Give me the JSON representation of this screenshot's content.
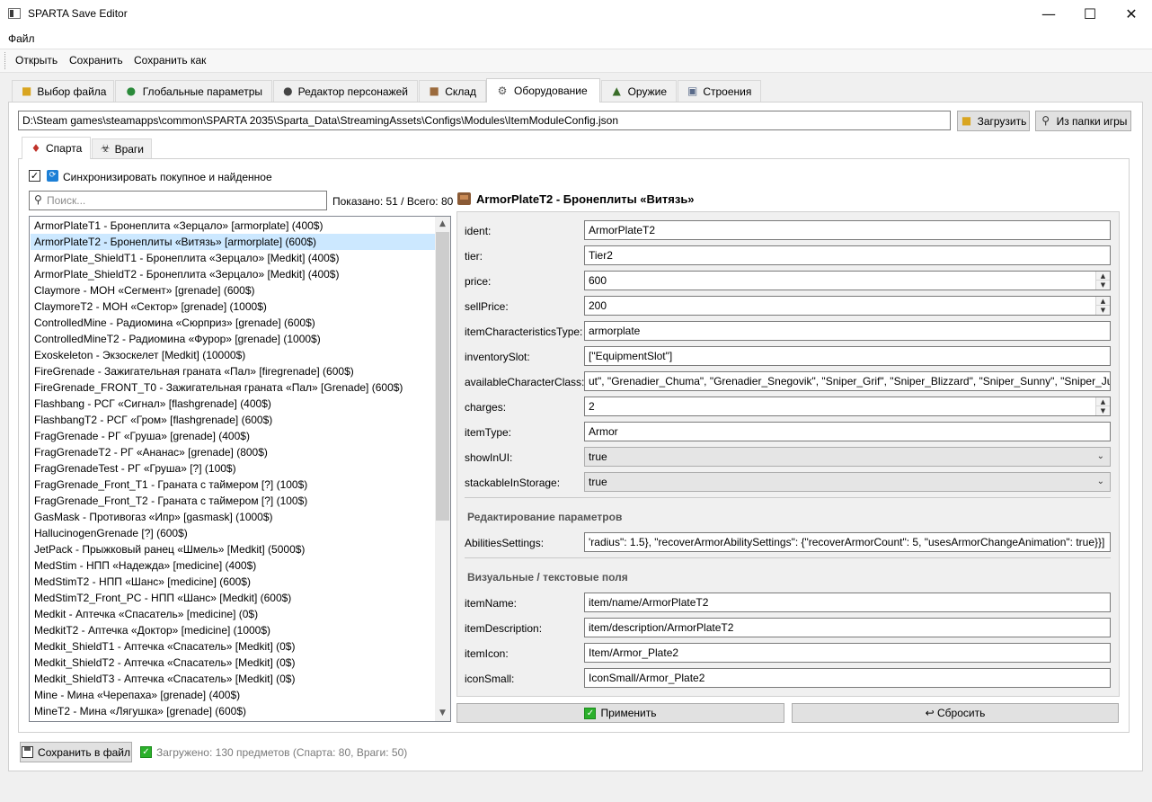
{
  "window": {
    "title": "SPARTA Save Editor",
    "minimize": "—",
    "maximize": "☐",
    "close": "✕"
  },
  "menu": {
    "file": "Файл"
  },
  "toolbar": {
    "open": "Открыть",
    "save": "Сохранить",
    "save_as": "Сохранить как"
  },
  "tabs": [
    {
      "label": "Выбор файла",
      "icon": "folder-icon"
    },
    {
      "label": "Глобальные параметры",
      "icon": "globe-icon"
    },
    {
      "label": "Редактор персонажей",
      "icon": "person-icon"
    },
    {
      "label": "Склад",
      "icon": "box-icon"
    },
    {
      "label": "Оборудование",
      "icon": "gear-icon"
    },
    {
      "label": "Оружие",
      "icon": "gun-icon"
    },
    {
      "label": "Строения",
      "icon": "building-icon"
    }
  ],
  "path": {
    "value": "D:\\Steam games\\steamapps\\common\\SPARTA 2035\\Sparta_Data\\StreamingAssets\\Configs\\Modules\\ItemModuleConfig.json",
    "load_button": "Загрузить",
    "game_folder_button": "Из папки игры"
  },
  "subtabs": [
    {
      "label": "Спарта",
      "icon": "shield-icon"
    },
    {
      "label": "Враги",
      "icon": "enemies-icon"
    }
  ],
  "sync": {
    "checked": true,
    "label": "Синхронизировать покупное и найденное"
  },
  "search": {
    "placeholder": "Поиск...",
    "count": "Показано: 51 / Всего: 80"
  },
  "items": [
    "ArmorPlateT1 - Бронеплита «Зерцало»  [armorplate]  (400$)",
    "ArmorPlateT2 - Бронеплиты «Витязь»  [armorplate]  (600$)",
    "ArmorPlate_ShieldT1 - Бронеплита «Зерцало»  [Medkit]  (400$)",
    "ArmorPlate_ShieldT2 - Бронеплита «Зерцало»  [Medkit]  (400$)",
    "Claymore - МОН «Сегмент»  [grenade]  (600$)",
    "ClaymoreT2 - МОН «Сектор»  [grenade]  (1000$)",
    "ControlledMine - Радиомина «Сюрприз»  [grenade]  (600$)",
    "ControlledMineT2 - Радиомина «Фурор»  [grenade]  (1000$)",
    "Exoskeleton - Экзоскелет  [Medkit]  (10000$)",
    "FireGrenade - Зажигательная граната «Пал»  [firegrenade]  (600$)",
    "FireGrenade_FRONT_T0 - Зажигательная граната «Пал»  [Grenade]  (600$)",
    "Flashbang - РСГ «Сигнал»  [flashgrenade]  (400$)",
    "FlashbangT2 - РСГ «Гром»  [flashgrenade]  (600$)",
    "FragGrenade - РГ «Груша»  [grenade]  (400$)",
    "FragGrenadeT2 - РГ «Ананас»  [grenade]  (800$)",
    "FragGrenadeTest - РГ «Груша»  [?]  (100$)",
    "FragGrenade_Front_T1 - Граната с таймером  [?]  (100$)",
    "FragGrenade_Front_T2 - Граната с таймером  [?]  (100$)",
    "GasMask - Противогаз «Ипр»  [gasmask]  (1000$)",
    "HallucinogenGrenade  [?]  (600$)",
    "JetPack - Прыжковый ранец «Шмель»  [Medkit]  (5000$)",
    "MedStim - НПП «Надежда»  [medicine]  (400$)",
    "MedStimT2 - НПП «Шанс»  [medicine]  (600$)",
    "MedStimT2_Front_PC - НПП «Шанс»  [Medkit]  (600$)",
    "Medkit - Аптечка «Спасатель»  [medicine]  (0$)",
    "MedkitT2 - Аптечка «Доктор»  [medicine]  (1000$)",
    "Medkit_ShieldT1 - Аптечка «Спасатель»  [Medkit]  (0$)",
    "Medkit_ShieldT2 - Аптечка «Спасатель»  [Medkit]  (0$)",
    "Medkit_ShieldT3 - Аптечка «Спасатель»  [Medkit]  (0$)",
    "Mine - Мина «Черепаха»  [grenade]  (400$)",
    "MineT2 - Мина «Лягушка»  [grenade]  (600$)"
  ],
  "selected_index": 1,
  "detail": {
    "title": "ArmorPlateT2 - Бронеплиты «Витязь»",
    "fields": {
      "ident": {
        "label": "ident:",
        "value": "ArmorPlateT2"
      },
      "tier": {
        "label": "tier:",
        "value": "Tier2"
      },
      "price": {
        "label": "price:",
        "value": "600"
      },
      "sellPrice": {
        "label": "sellPrice:",
        "value": "200"
      },
      "itemCharacteristicsType": {
        "label": "itemCharacteristicsType:",
        "value": "armorplate"
      },
      "inventorySlot": {
        "label": "inventorySlot:",
        "value": "[\"EquipmentSlot\"]"
      },
      "availableCharacterClass": {
        "label": "availableCharacterClass:",
        "value": "ut\", \"Grenadier_Chuma\", \"Grenadier_Snegovik\", \"Sniper_Grif\", \"Sniper_Blizzard\", \"Sniper_Sunny\", \"Sniper_Julia\"]"
      },
      "charges": {
        "label": "charges:",
        "value": "2"
      },
      "itemType": {
        "label": "itemType:",
        "value": "Armor"
      },
      "showInUI": {
        "label": "showInUI:",
        "value": "true"
      },
      "stackableInStorage": {
        "label": "stackableInStorage:",
        "value": "true"
      }
    },
    "section_params": "Редактирование параметров",
    "abilities": {
      "label": "AbilitiesSettings:",
      "value": "'radius\": 1.5}, \"recoverArmorAbilitySettings\": {\"recoverArmorCount\": 5, \"usesArmorChangeAnimation\": true}}]"
    },
    "section_visual": "Визуальные / текстовые поля",
    "visual": {
      "itemName": {
        "label": "itemName:",
        "value": "item/name/ArmorPlateT2"
      },
      "itemDescription": {
        "label": "itemDescription:",
        "value": "item/description/ArmorPlateT2"
      },
      "itemIcon": {
        "label": "itemIcon:",
        "value": "Item/Armor_Plate2"
      },
      "iconSmall": {
        "label": "iconSmall:",
        "value": "IconSmall/Armor_Plate2"
      }
    }
  },
  "actions": {
    "apply": "Применить",
    "reset": "↩ Сбросить"
  },
  "footer": {
    "save_file": "Сохранить в файл",
    "status": "Загружено: 130 предметов (Спарта: 80, Враги: 50)"
  }
}
